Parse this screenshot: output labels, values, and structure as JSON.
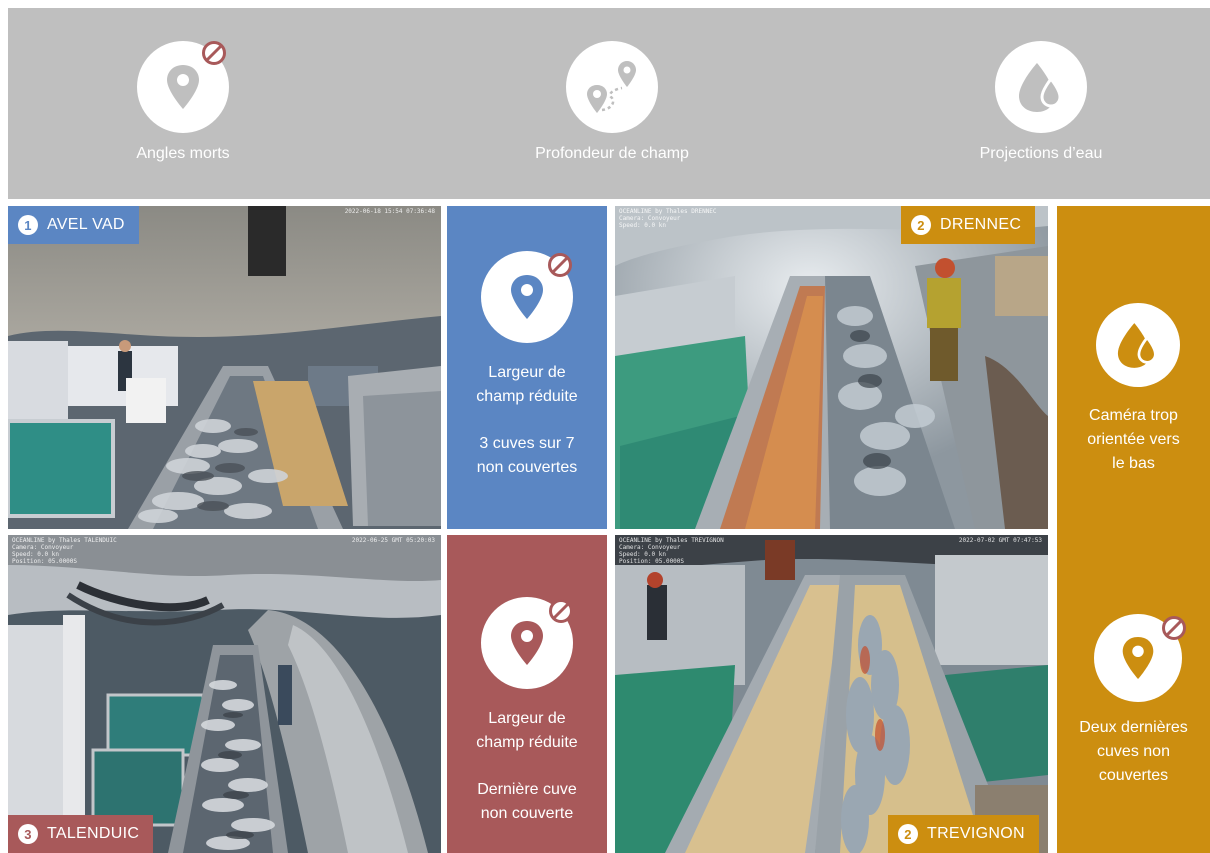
{
  "colors": {
    "blue": "#5b86c3",
    "red": "#a8595a",
    "gold": "#cc8e10",
    "banner": "#bfbfbf"
  },
  "legend": [
    {
      "icon": "map-pin-blocked-icon",
      "label": "Angles morts"
    },
    {
      "icon": "route-pins-icon",
      "label": "Profondeur de champ"
    },
    {
      "icon": "water-drops-icon",
      "label": "Projections d’eau"
    }
  ],
  "vessels": {
    "avel_vad": {
      "num": "1",
      "name": "AVEL VAD"
    },
    "drennec": {
      "num": "2",
      "name": "DRENNEC"
    },
    "talenduic": {
      "num": "3",
      "name": "TALENDUIC"
    },
    "trevignon": {
      "num": "2",
      "name": "TREVIGNON"
    }
  },
  "panels": {
    "blue": {
      "icon": "map-pin-blocked-icon",
      "line1": "Largeur de",
      "line2": "champ réduite",
      "line3": "3 cuves sur 7",
      "line4": "non couvertes"
    },
    "red": {
      "icon": "map-pin-blocked-icon",
      "line1": "Largeur de",
      "line2": "champ réduite",
      "line3": "Dernière cuve",
      "line4": "non couverte"
    },
    "gold_top": {
      "icon": "water-drops-icon",
      "line1": "Caméra trop",
      "line2": "orientée vers",
      "line3": "le bas"
    },
    "gold_bottom": {
      "icon": "map-pin-blocked-icon",
      "line1": "Deux dernières",
      "line2": "cuves non",
      "line3": "couvertes"
    }
  }
}
